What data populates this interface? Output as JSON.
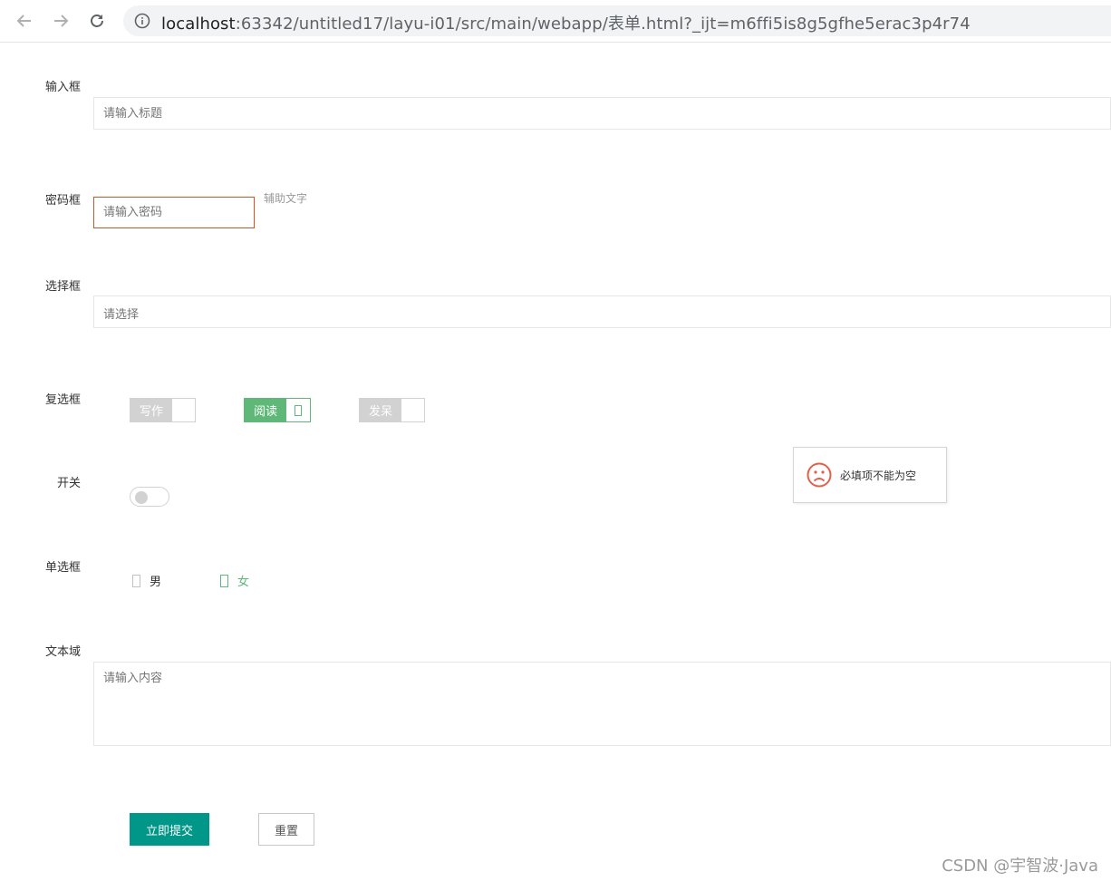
{
  "browser": {
    "url_host": "localhost",
    "url_rest": ":63342/untitled17/layu-i01/src/main/webapp/表单.html?_ijt=m6ffi5is8g5gfhe5erac3p4r74",
    "icons": {
      "back": "arrow-left-icon",
      "forward": "arrow-right-icon",
      "reload": "reload-icon",
      "site_info": "info-circle-icon"
    }
  },
  "form": {
    "title_field": {
      "label": "输入框",
      "placeholder": "请输入标题",
      "value": ""
    },
    "password_field": {
      "label": "密码框",
      "placeholder": "请输入密码",
      "value": "",
      "aux_text": "辅助文字",
      "border_color": "#d9531e"
    },
    "select_field": {
      "label": "选择框",
      "placeholder": "请选择"
    },
    "checkbox_group": {
      "label": "复选框",
      "items": [
        {
          "text": "写作",
          "checked": false
        },
        {
          "text": "阅读",
          "checked": true
        },
        {
          "text": "发呆",
          "checked": false
        }
      ]
    },
    "switch_field": {
      "label": "开关",
      "on": false
    },
    "radio_group": {
      "label": "单选框",
      "items": [
        {
          "text": "男",
          "checked": false
        },
        {
          "text": "女",
          "checked": true
        }
      ]
    },
    "textarea_field": {
      "label": "文本域",
      "placeholder": "请输入内容",
      "value": ""
    },
    "buttons": {
      "submit": "立即提交",
      "reset": "重置"
    }
  },
  "toast": {
    "icon": "sad-face-icon",
    "message": "必填项不能为空"
  },
  "watermark": "CSDN @宇智波·Java",
  "colors": {
    "checked_green": "#5fb878",
    "primary_teal": "#009688",
    "unchecked_gray": "#d2d2d2",
    "error_red": "#e45f4a"
  }
}
